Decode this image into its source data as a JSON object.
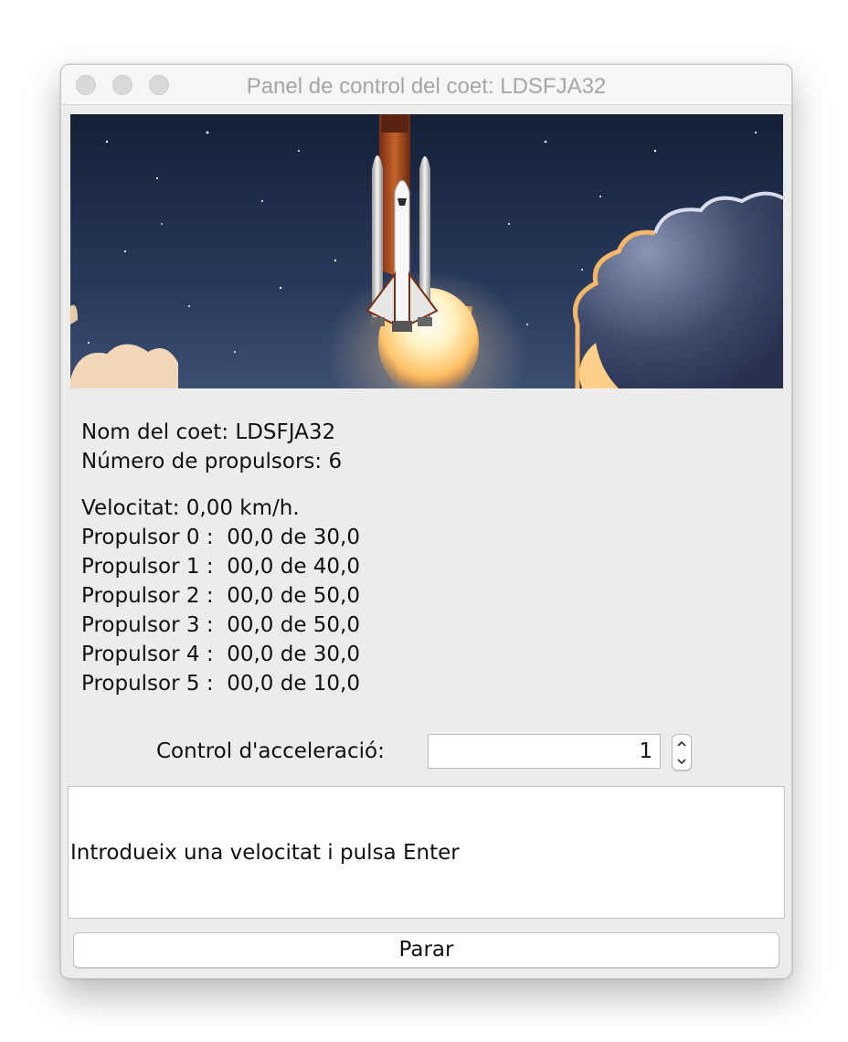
{
  "window": {
    "title": "Panel de control del coet: LDSFJA32"
  },
  "banner": {
    "icon": "rocket-launch-image"
  },
  "info": {
    "name_line": "Nom del coet: LDSFJA32",
    "thrusters_line": "Número de propulsors: 6",
    "speed_line": "Velocitat: 0,00 km/h.",
    "thrusters": [
      "Propulsor 0 :  00,0 de 30,0",
      "Propulsor 1 :  00,0 de 40,0",
      "Propulsor 2 :  00,0 de 50,0",
      "Propulsor 3 :  00,0 de 50,0",
      "Propulsor 4 :  00,0 de 30,0",
      "Propulsor 5 :  00,0 de 10,0"
    ]
  },
  "acceleration": {
    "label": "Control d'acceleració:",
    "value": "1"
  },
  "message": {
    "text": "Introdueix una velocitat i pulsa Enter"
  },
  "stop_button": {
    "label": "Parar"
  }
}
